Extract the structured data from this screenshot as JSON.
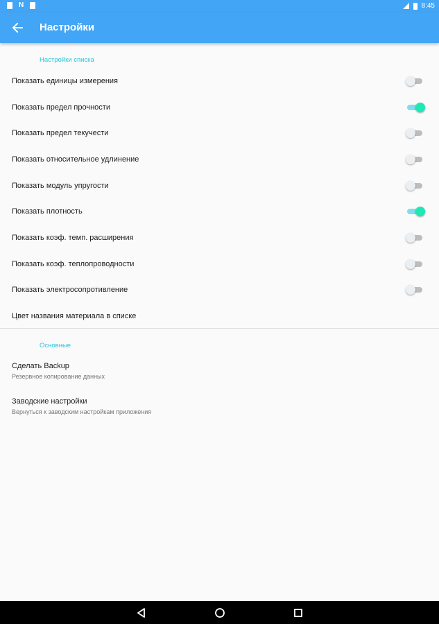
{
  "status_bar": {
    "time": "8:45",
    "left_icons": [
      "notification-icon",
      "n-notification-icon",
      "notification-icon"
    ],
    "right_icons": [
      "signal-icon",
      "battery-icon"
    ]
  },
  "app_bar": {
    "title": "Настройки",
    "back_icon": "arrow-back-icon",
    "color": "#42a5f5"
  },
  "list_settings": {
    "header": "Настройки списка",
    "items": [
      {
        "label": "Показать единицы измерения",
        "on": false
      },
      {
        "label": "Показать предел прочности",
        "on": true
      },
      {
        "label": "Показать предел текучести",
        "on": false
      },
      {
        "label": "Показать относительное удлинение",
        "on": false
      },
      {
        "label": "Показать модуль упругости",
        "on": false
      },
      {
        "label": "Показать плотность",
        "on": true
      },
      {
        "label": "Показать коэф. темп. расширения",
        "on": false
      },
      {
        "label": "Показать коэф. теплопроводности",
        "on": false
      },
      {
        "label": "Показать электросопротивление",
        "on": false
      }
    ],
    "color_item": "Цвет названия материала в списке"
  },
  "main_settings": {
    "header": "Основные",
    "items": [
      {
        "title": "Сделать Backup",
        "summary": "Резервное копирование данных"
      },
      {
        "title": "Заводские настройки",
        "summary": "Вернуться к заводским настройкам приложения"
      }
    ]
  },
  "nav_bar": {
    "icons": [
      "back-triangle-icon",
      "home-circle-icon",
      "recents-square-icon"
    ]
  },
  "colors": {
    "accent": "#26c6da",
    "switch_on": "#1de9b6"
  }
}
